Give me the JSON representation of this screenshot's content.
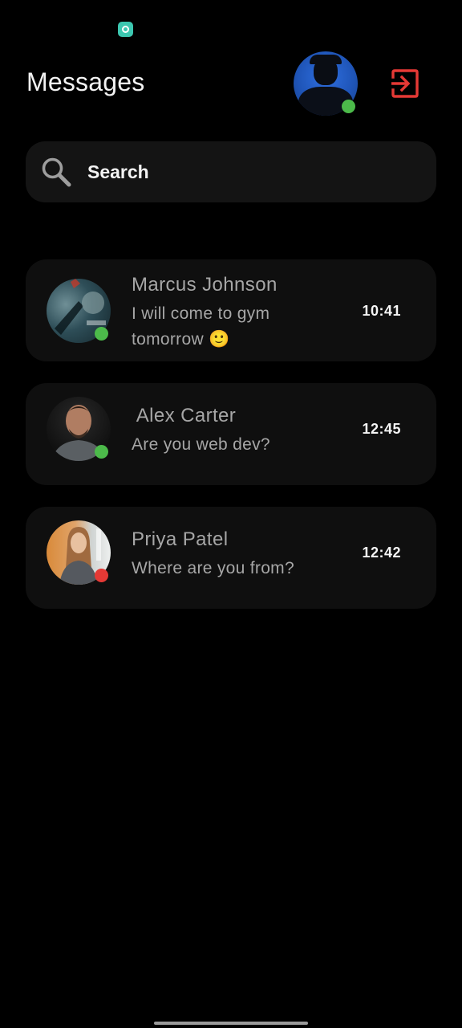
{
  "header": {
    "title": "Messages",
    "profile_status": "online",
    "logout_icon": "logout-icon",
    "accent_logout": "#e53935"
  },
  "search": {
    "placeholder": "Search",
    "value": "",
    "icon": "search-icon"
  },
  "chats": [
    {
      "name": "Marcus Johnson",
      "message": "I will come to gym tomorrow 🙂",
      "time": "10:41",
      "status": "online",
      "status_color": "#4cba4a"
    },
    {
      "name": " Alex Carter",
      "message": "Are you web dev?",
      "time": "12:45",
      "status": "online",
      "status_color": "#4cba4a"
    },
    {
      "name": "Priya Patel",
      "message": "Where are you from?",
      "time": "12:42",
      "status": "offline",
      "status_color": "#e53935"
    }
  ],
  "colors": {
    "background": "#000000",
    "card": "#0f0f0f",
    "search_bg": "#141414",
    "online": "#4cba4a",
    "offline": "#e53935"
  }
}
